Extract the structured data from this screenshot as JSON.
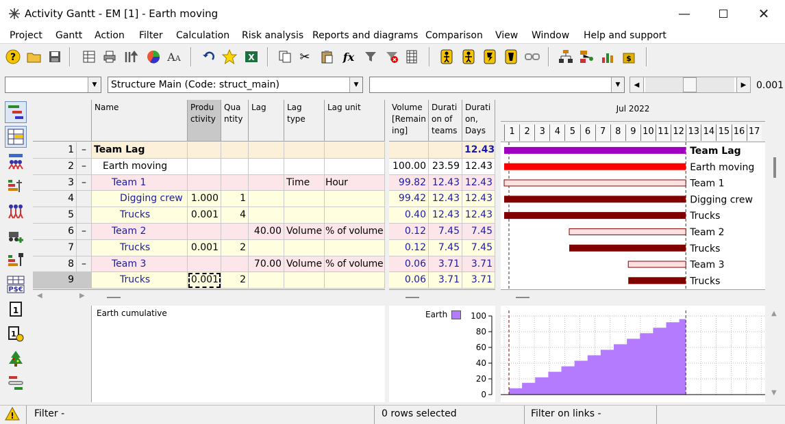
{
  "window": {
    "title": "Activity Gantt - EM [1] - Earth moving"
  },
  "menu": [
    "Project",
    "Gantt",
    "Action",
    "Filter",
    "Calculation",
    "Risk analysis",
    "Reports and diagrams",
    "Comparison",
    "View",
    "Window",
    "Help and support"
  ],
  "combos": {
    "first": "",
    "structure": "Structure Main (Code: struct_main)",
    "third": "",
    "zoom_value": "0.001"
  },
  "grid": {
    "headers": {
      "name": "Name",
      "productivity": "Produ ctivity",
      "quantity": "Qua ntity",
      "lag": "Lag",
      "lag_type": "Lag type",
      "lag_unit": "Lag unit",
      "volume": "Volume [Remain ing]",
      "duration_teams": "Durati on of teams",
      "duration_days": "Durati on, Days"
    },
    "rows": [
      {
        "num": "1",
        "exp": "–",
        "name": "Team Lag",
        "productivity": "",
        "quantity": "",
        "lag": "",
        "lag_type": "",
        "lag_unit": "",
        "volume": "",
        "dur_teams": "",
        "dur_days": "12.43"
      },
      {
        "num": "2",
        "exp": "–",
        "name": "Earth moving",
        "productivity": "",
        "quantity": "",
        "lag": "",
        "lag_type": "",
        "lag_unit": "",
        "volume": "100.00",
        "dur_teams": "23.59",
        "dur_days": "12.43"
      },
      {
        "num": "3",
        "exp": "–",
        "name": "Team 1",
        "productivity": "",
        "quantity": "",
        "lag": "",
        "lag_type": "Time",
        "lag_unit": "Hour",
        "volume": "99.82",
        "dur_teams": "12.43",
        "dur_days": "12.43"
      },
      {
        "num": "4",
        "exp": "",
        "name": "Digging crew",
        "productivity": "1.000",
        "quantity": "1",
        "lag": "",
        "lag_type": "",
        "lag_unit": "",
        "volume": "99.42",
        "dur_teams": "12.43",
        "dur_days": "12.43"
      },
      {
        "num": "5",
        "exp": "",
        "name": "Trucks",
        "productivity": "0.001",
        "quantity": "4",
        "lag": "",
        "lag_type": "",
        "lag_unit": "",
        "volume": "0.40",
        "dur_teams": "12.43",
        "dur_days": "12.43"
      },
      {
        "num": "6",
        "exp": "–",
        "name": "Team 2",
        "productivity": "",
        "quantity": "",
        "lag": "40.00",
        "lag_type": "Volume",
        "lag_unit": "% of volume",
        "volume": "0.12",
        "dur_teams": "7.45",
        "dur_days": "7.45"
      },
      {
        "num": "7",
        "exp": "",
        "name": "Trucks",
        "productivity": "0.001",
        "quantity": "2",
        "lag": "",
        "lag_type": "",
        "lag_unit": "",
        "volume": "0.12",
        "dur_teams": "7.45",
        "dur_days": "7.45"
      },
      {
        "num": "8",
        "exp": "–",
        "name": "Team 3",
        "productivity": "",
        "quantity": "",
        "lag": "70.00",
        "lag_type": "Volume",
        "lag_unit": "% of volume",
        "volume": "0.06",
        "dur_teams": "3.71",
        "dur_days": "3.71"
      },
      {
        "num": "9",
        "exp": "",
        "name": "Trucks",
        "productivity": "0.001",
        "quantity": "2",
        "lag": "",
        "lag_type": "",
        "lag_unit": "",
        "volume": "0.06",
        "dur_teams": "3.71",
        "dur_days": "3.71"
      }
    ]
  },
  "gantt": {
    "month": "Jul 2022",
    "days": [
      "1",
      "2",
      "3",
      "4",
      "5",
      "6",
      "7",
      "8",
      "9",
      "10",
      "11",
      "12",
      "13",
      "14",
      "15",
      "16",
      "17"
    ],
    "bars": [
      {
        "label": "Team Lag",
        "start_day": 1.0,
        "end_day": 13.0,
        "color": "#a000c0",
        "style": "solid"
      },
      {
        "label": "Earth moving",
        "start_day": 1.0,
        "end_day": 13.0,
        "color": "#ff0000",
        "style": "solid"
      },
      {
        "label": "Team 1",
        "start_day": 1.0,
        "end_day": 13.0,
        "color": "#ffe0e0",
        "style": "outline"
      },
      {
        "label": "Digging crew",
        "start_day": 1.0,
        "end_day": 13.0,
        "color": "#800000",
        "style": "solid"
      },
      {
        "label": "Trucks",
        "start_day": 1.0,
        "end_day": 13.0,
        "color": "#800000",
        "style": "solid"
      },
      {
        "label": "Team 2",
        "start_day": 5.3,
        "end_day": 13.0,
        "color": "#ffe0e0",
        "style": "outline"
      },
      {
        "label": "Trucks",
        "start_day": 5.3,
        "end_day": 13.0,
        "color": "#800000",
        "style": "solid"
      },
      {
        "label": "Team 3",
        "start_day": 9.2,
        "end_day": 13.0,
        "color": "#ffe0e0",
        "style": "outline"
      },
      {
        "label": "Trucks",
        "start_day": 9.2,
        "end_day": 13.0,
        "color": "#800000",
        "style": "solid"
      }
    ]
  },
  "histogram": {
    "title": "Earth cumulative",
    "legend": "Earth",
    "color": "#b57bff",
    "chart_data": {
      "type": "area",
      "series": [
        {
          "name": "Earth",
          "values": [
            8,
            8,
            15,
            15,
            22,
            22,
            29,
            29,
            36,
            36,
            43,
            43,
            50,
            50,
            57,
            57,
            64,
            64,
            71,
            71,
            78,
            78,
            85,
            85,
            92,
            92,
            96
          ]
        }
      ],
      "ylim": [
        0,
        100
      ],
      "yticks": [
        "0",
        "20",
        "40",
        "60",
        "80",
        "100"
      ],
      "x_start_day": 1,
      "x_end_day": 13
    }
  },
  "status": {
    "filter": "Filter -",
    "selected": "0 rows selected",
    "links": "Filter on links -"
  }
}
